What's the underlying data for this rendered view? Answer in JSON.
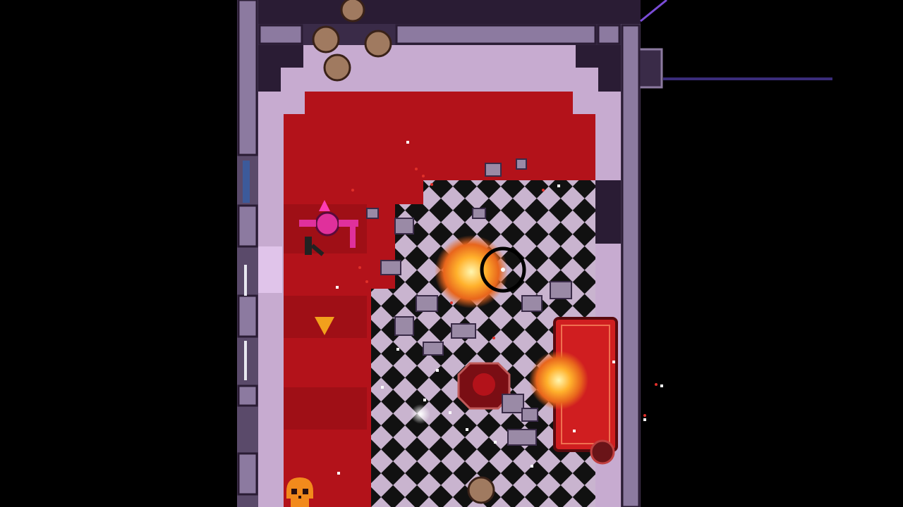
{
  "scene": {
    "type": "top-down room",
    "background_color": "#000000",
    "wall_color": "#a88ab8",
    "carpet_color": "#b3121a",
    "floor_pattern": "checkerboard"
  },
  "player": {
    "icon": "pink-gunman"
  },
  "crosshair": {
    "icon": "crosshair-icon"
  },
  "objective_marker": {
    "icon": "arrow-down-icon",
    "color": "#f2a01c"
  },
  "hud": {
    "icon": "skull-icon",
    "color": "#f28a1c"
  }
}
